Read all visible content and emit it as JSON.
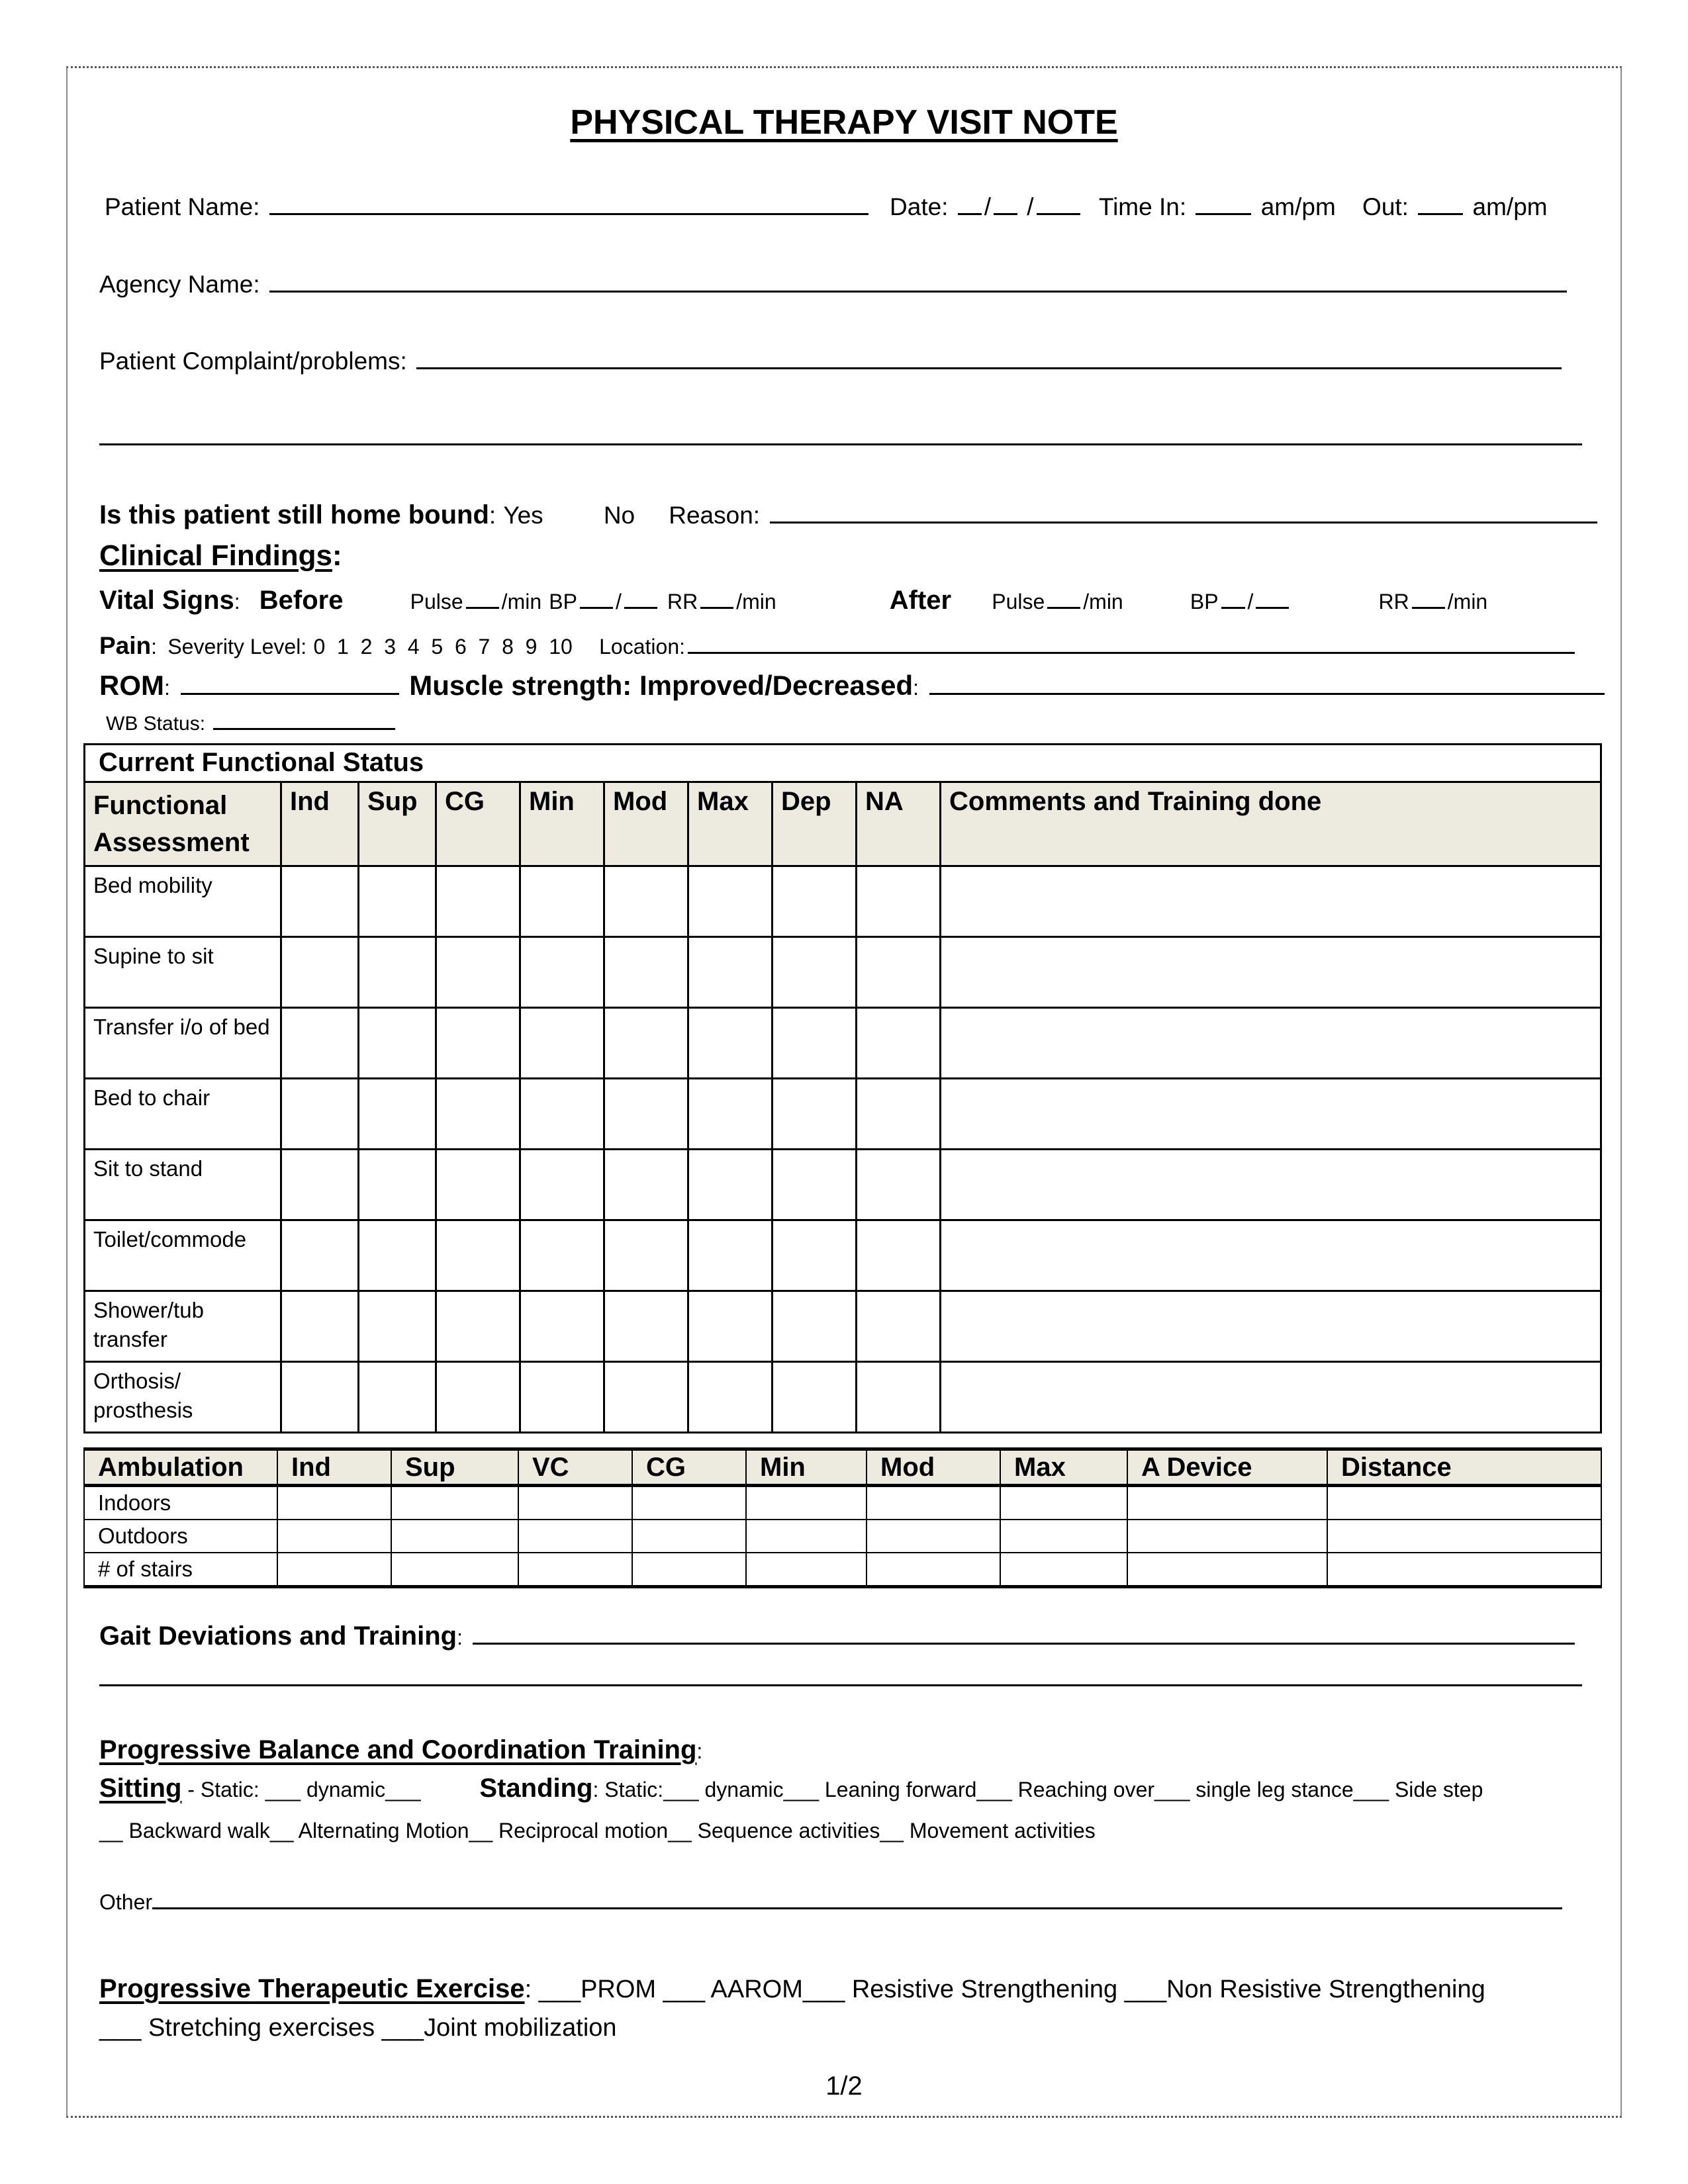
{
  "title": "PHYSICAL THERAPY VISIT NOTE",
  "header": {
    "patient_name_label": "Patient Name:",
    "date_label": "Date:",
    "date_sep": "/",
    "time_in_label": "Time In:",
    "time_out_label": "Out:",
    "ampm": "am/pm",
    "agency_label": "Agency Name:",
    "complaint_label": "Patient Complaint/problems:"
  },
  "homebound": {
    "question": "Is this patient still home bound",
    "yes": "Yes",
    "no": "No",
    "reason_label": "Reason:"
  },
  "clinical": {
    "heading": "Clinical Findings",
    "vitals_label": "Vital Signs",
    "before_label": "Before",
    "after_label": "After",
    "pulse_label": "Pulse",
    "per_min": "/min",
    "bp_label": "BP",
    "rr_label": "RR",
    "pain_label": "Pain",
    "severity_label": "Severity Level:",
    "severity_scale": "0  1  2  3  4  5  6  7  8  9  10",
    "location_label": "Location:",
    "rom_label": "ROM",
    "muscle_label": "Muscle strength:  Improved/Decreased",
    "wb_label": "WB Status:"
  },
  "functional_table": {
    "caption": "Current Functional Status",
    "headers": [
      "Functional Assessment",
      "Ind",
      "Sup",
      "CG",
      "Min",
      "Mod",
      "Max",
      "Dep",
      "NA",
      "Comments and Training done"
    ],
    "rows": [
      "Bed mobility",
      "Supine to sit",
      "Transfer i/o of bed",
      "Bed to chair",
      "Sit to stand",
      "Toilet/commode",
      "Shower/tub transfer",
      "Orthosis/ prosthesis"
    ]
  },
  "ambulation_table": {
    "headers": [
      "Ambulation",
      "Ind",
      "Sup",
      "VC",
      "CG",
      "Min",
      "Mod",
      "Max",
      "A Device",
      "Distance"
    ],
    "rows": [
      "Indoors",
      "Outdoors",
      "# of stairs"
    ]
  },
  "gait": {
    "label": "Gait Deviations and Training"
  },
  "balance": {
    "heading": "Progressive Balance and Coordination Training",
    "sitting_label": "Sitting",
    "sitting_items": "Static: ___ dynamic___",
    "standing_label": "Standing",
    "standing_items": "Static:___  dynamic___ Leaning forward___ Reaching over___ single leg stance___ Side step",
    "line2": "__ Backward walk__ Alternating Motion__ Reciprocal motion__ Sequence activities__ Movement activities",
    "other_label": "Other"
  },
  "exercise": {
    "heading": "Progressive Therapeutic Exercise",
    "line1": "___PROM ___ AAROM___ Resistive Strengthening ___Non Resistive Strengthening",
    "line2": "___ Stretching exercises ___Joint mobilization"
  },
  "page_number": "1/2"
}
